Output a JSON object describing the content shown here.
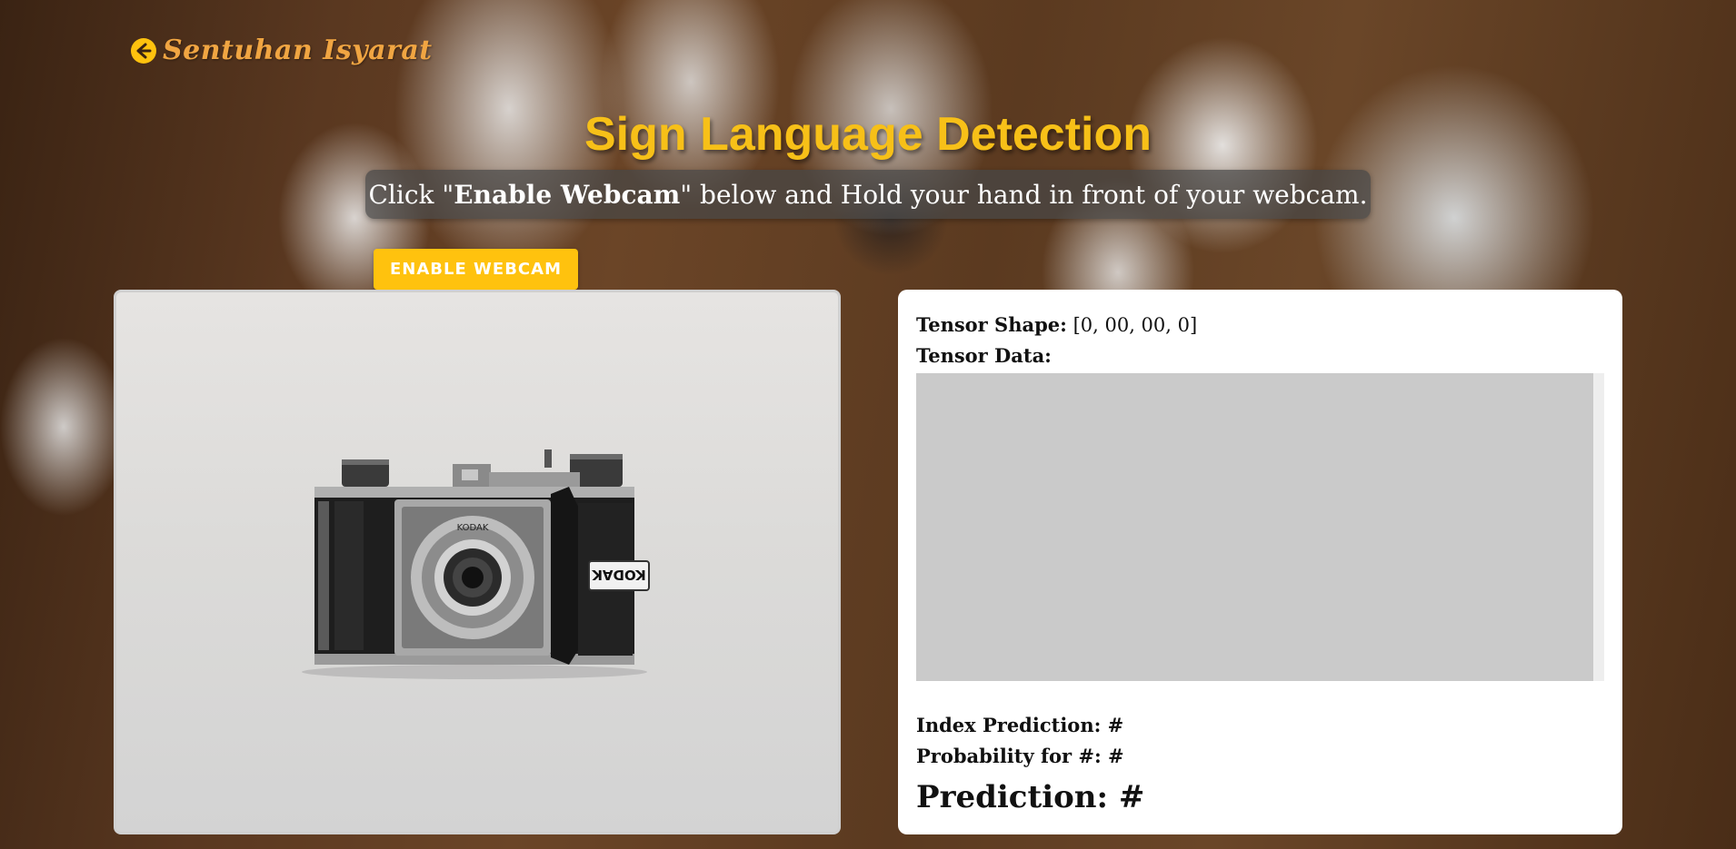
{
  "header": {
    "logo_text": "Sentuhan Isyarat",
    "back_icon": "arrow-left-circle-icon"
  },
  "title": "Sign Language Detection",
  "instruction": {
    "prefix": "Click \"",
    "bold": "Enable Webcam",
    "suffix": "\" below and Hold your hand in front of your webcam."
  },
  "enable_button": "ENABLE WEBCAM",
  "webcam": {
    "placeholder_image": "kodak-camera-photo",
    "camera_brand_text": "KODAK"
  },
  "info": {
    "tensor_shape_label": "Tensor Shape:",
    "tensor_shape_value": " [0, 00, 00, 0]",
    "tensor_data_label": "Tensor Data:",
    "index_prediction_label": "Index Prediction:",
    "index_prediction_value": " #",
    "probability_label": "Probability for #:",
    "probability_value": " #",
    "prediction_label": "Prediction:",
    "prediction_value": " #"
  },
  "colors": {
    "accent": "#ffc20e",
    "title": "#f7c018",
    "logo": "#f0a542"
  }
}
